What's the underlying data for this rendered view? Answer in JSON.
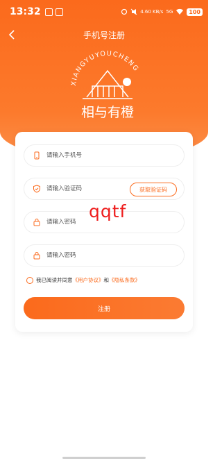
{
  "status_bar": {
    "time": "13:32",
    "net_speed": "4.60 KB/s",
    "network": "5G",
    "battery": "100"
  },
  "nav": {
    "title": "手机号注册"
  },
  "logo": {
    "arc_text": "XIANGYUYOUCHENG",
    "name": "相与有橙"
  },
  "form": {
    "phone_placeholder": "请输入手机号",
    "code_placeholder": "请输入验证码",
    "get_code_label": "获取验证码",
    "password_placeholder": "请输入密码",
    "confirm_placeholder": "请输入密码"
  },
  "agreement": {
    "prefix": "我已阅读并同意",
    "user_link": "《用户协议》",
    "and": "和",
    "privacy_link": "《隐私条款》"
  },
  "submit_label": "注册",
  "watermark": "qqtf",
  "colors": {
    "accent": "#fb6a1c",
    "watermark": "#ee1c1c"
  }
}
